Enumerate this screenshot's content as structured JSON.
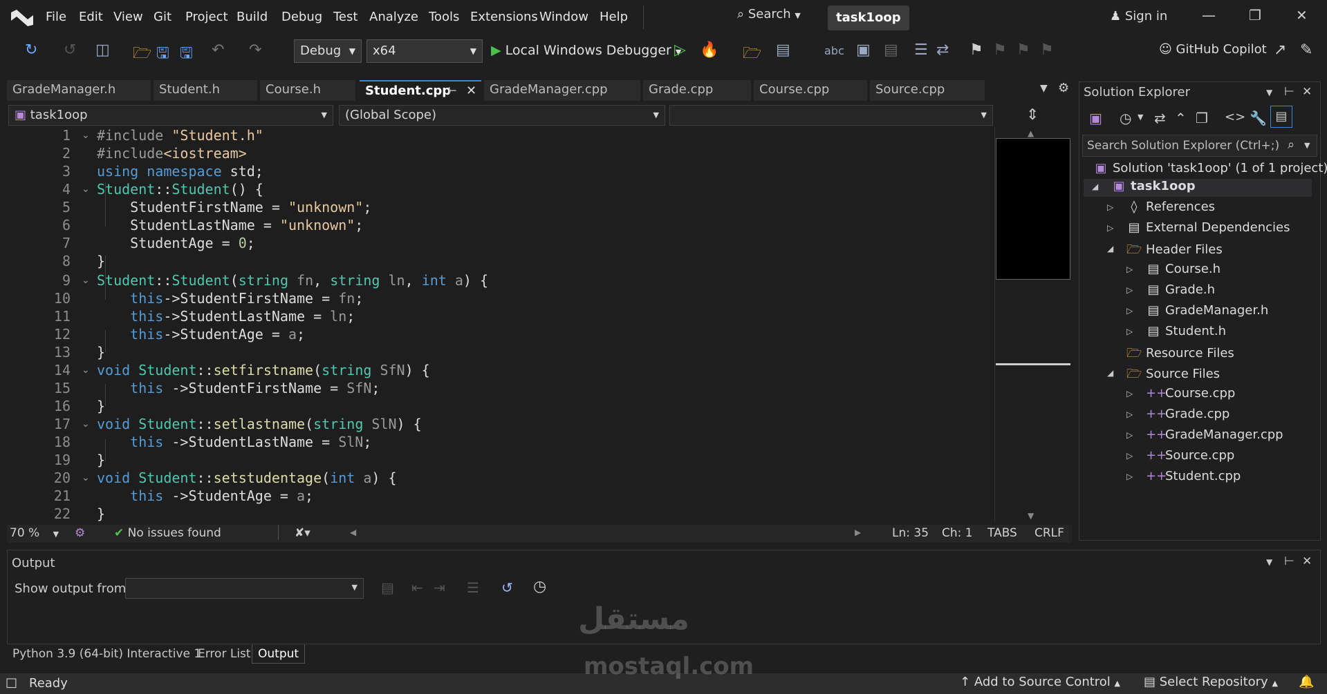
{
  "menu": [
    "File",
    "Edit",
    "View",
    "Git",
    "Project",
    "Build",
    "Debug",
    "Test",
    "Analyze",
    "Tools",
    "Extensions",
    "Window",
    "Help"
  ],
  "search_label": "Search",
  "solution_title": "task1oop",
  "sign_in": "Sign in",
  "toolbar": {
    "config": "Debug",
    "platform": "x64",
    "debugger": "Local Windows Debugger",
    "copilot": "GitHub Copilot"
  },
  "tabs": [
    "GradeManager.h",
    "Student.h",
    "Course.h",
    "Student.cpp",
    "GradeManager.cpp",
    "Grade.cpp",
    "Course.cpp",
    "Source.cpp"
  ],
  "nav": {
    "project": "task1oop",
    "scope": "(Global Scope)"
  },
  "code_lines": [
    "1",
    "2",
    "3",
    "4",
    "5",
    "6",
    "7",
    "8",
    "9",
    "10",
    "11",
    "12",
    "13",
    "14",
    "15",
    "16",
    "17",
    "18",
    "19",
    "20",
    "21",
    "22"
  ],
  "editor_status": {
    "zoom": "70 %",
    "issues": "No issues found",
    "ln": "Ln: 35",
    "ch": "Ch: 1",
    "tabs": "TABS",
    "eol": "CRLF"
  },
  "output": {
    "title": "Output",
    "show_from": "Show output from:"
  },
  "bottom_tabs": [
    "Python 3.9 (64-bit) Interactive 1",
    "Error List",
    "Output"
  ],
  "solution_explorer": {
    "title": "Solution Explorer",
    "search_placeholder": "Search Solution Explorer (Ctrl+;)",
    "solution": "Solution 'task1oop' (1 of 1 project)",
    "project": "task1oop",
    "references": "References",
    "external": "External Dependencies",
    "header_files": "Header Files",
    "headers": [
      "Course.h",
      "Grade.h",
      "GradeManager.h",
      "Student.h"
    ],
    "resource_files": "Resource Files",
    "source_files": "Source Files",
    "sources": [
      "Course.cpp",
      "Grade.cpp",
      "GradeManager.cpp",
      "Source.cpp",
      "Student.cpp"
    ]
  },
  "statusbar": {
    "ready": "Ready",
    "add_source": "Add to Source Control",
    "select_repo": "Select Repository"
  },
  "watermark": {
    "arabic": "مستقل",
    "latin": "mostaql.com"
  }
}
